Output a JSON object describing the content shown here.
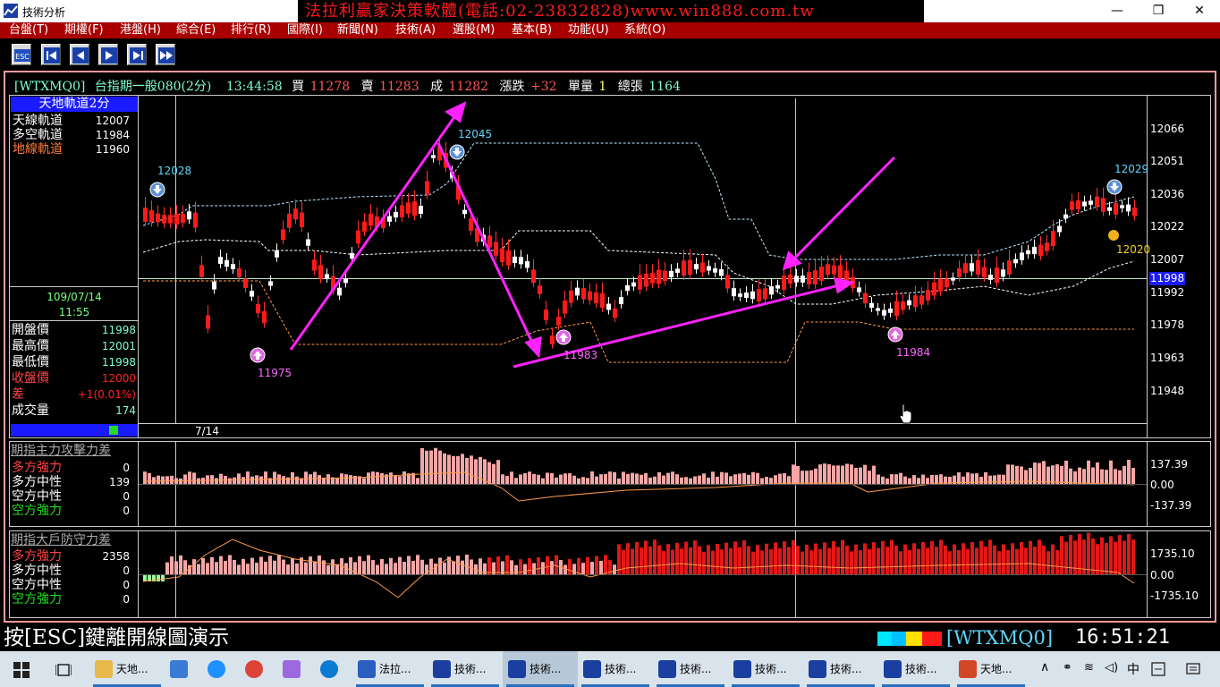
{
  "window": {
    "title": "技術分析",
    "banner": "法拉利贏家決策軟體(電話:02-23832828)www.win888.com.tw",
    "controls": [
      "—",
      "❐",
      "✕"
    ]
  },
  "menu": [
    "台盤(T)",
    "期權(F)",
    "港盤(H)",
    "綜合(E)",
    "排行(R)",
    "國際(I)",
    "新聞(N)",
    "技術(A)",
    "選股(M)",
    "基本(B)",
    "功能(U)",
    "系統(O)"
  ],
  "toolbar": {
    "esc_label": "ESC"
  },
  "quote": {
    "symbol": "[WTXMQ0]",
    "name": "台指期一般080(2分)",
    "time": "13:44:58",
    "buy_label": "買",
    "buy": "11278",
    "sell_label": "賣",
    "sell": "11283",
    "deal_label": "成",
    "deal": "11282",
    "change_label": "漲跌",
    "change": "+32",
    "volume_label": "單量",
    "volume": "1",
    "total_label": "總張",
    "total": "1164"
  },
  "indicator_panel": {
    "title": "天地軌道2分",
    "rows": [
      {
        "label": "天線軌道",
        "value": "12007"
      },
      {
        "label": "多空軌道",
        "value": "11984"
      },
      {
        "label": "地線軌道",
        "value": "11960"
      }
    ]
  },
  "datetime": {
    "date": "109/07/14",
    "time": "11:55"
  },
  "ohlc": [
    {
      "label": "開盤價",
      "value": "11998"
    },
    {
      "label": "最高價",
      "value": "12001"
    },
    {
      "label": "最低價",
      "value": "11998"
    },
    {
      "label": "收盤價",
      "value": "12000"
    },
    {
      "label": "差",
      "value": "+1(0.01%)"
    },
    {
      "label": "成交量",
      "value": "174"
    }
  ],
  "price_axis": [
    "12066",
    "12051",
    "12036",
    "12022",
    "12007",
    "11992",
    "11978",
    "11963",
    "11948"
  ],
  "current_price": "11998",
  "date_label": "7/14",
  "annotations": {
    "high1": "12045",
    "high_left": "12028",
    "high_right": "12029",
    "low1": "11975",
    "low2": "11983",
    "low3": "11984",
    "mid_right": "12020"
  },
  "sub1": {
    "title": "期指主力攻擊力差",
    "rows": [
      {
        "label": "多方強力",
        "value": "0"
      },
      {
        "label": "多方中性",
        "value": "139"
      },
      {
        "label": "空方中性",
        "value": "0"
      },
      {
        "label": "空方強力",
        "value": "0"
      }
    ],
    "axis": [
      "137.39",
      "0.00",
      "-137.39"
    ]
  },
  "sub2": {
    "title": "期指大戶防守力差",
    "rows": [
      {
        "label": "多方強力",
        "value": "2358"
      },
      {
        "label": "多方中性",
        "value": "0"
      },
      {
        "label": "空方中性",
        "value": "0"
      },
      {
        "label": "空方強力",
        "value": "0"
      }
    ],
    "axis": [
      "1735.10",
      "0.00",
      "-1735.10"
    ]
  },
  "status": {
    "hint": "按[ESC]鍵離開線圖演示",
    "symbol": "[WTXMQ0]",
    "clock": "16:51:21"
  },
  "taskbar": {
    "tasks": [
      {
        "label": "天地...",
        "icon": "folder-icon"
      },
      {
        "label": "",
        "icon": "computer-icon"
      },
      {
        "label": "",
        "icon": "ie-icon"
      },
      {
        "label": "",
        "icon": "chrome-icon"
      },
      {
        "label": "",
        "icon": "paint-icon"
      },
      {
        "label": "",
        "icon": "edge-icon"
      },
      {
        "label": "法拉...",
        "icon": "app-icon"
      },
      {
        "label": "技術...",
        "icon": "chart-icon"
      },
      {
        "label": "技術...",
        "icon": "chart-icon"
      },
      {
        "label": "技術...",
        "icon": "chart-icon"
      },
      {
        "label": "技術...",
        "icon": "chart-icon"
      },
      {
        "label": "技術...",
        "icon": "chart-icon"
      },
      {
        "label": "技術...",
        "icon": "chart-icon"
      },
      {
        "label": "技術...",
        "icon": "chart-icon"
      },
      {
        "label": "天地...",
        "icon": "powerpoint-icon"
      }
    ],
    "tray_ime": "中"
  }
}
